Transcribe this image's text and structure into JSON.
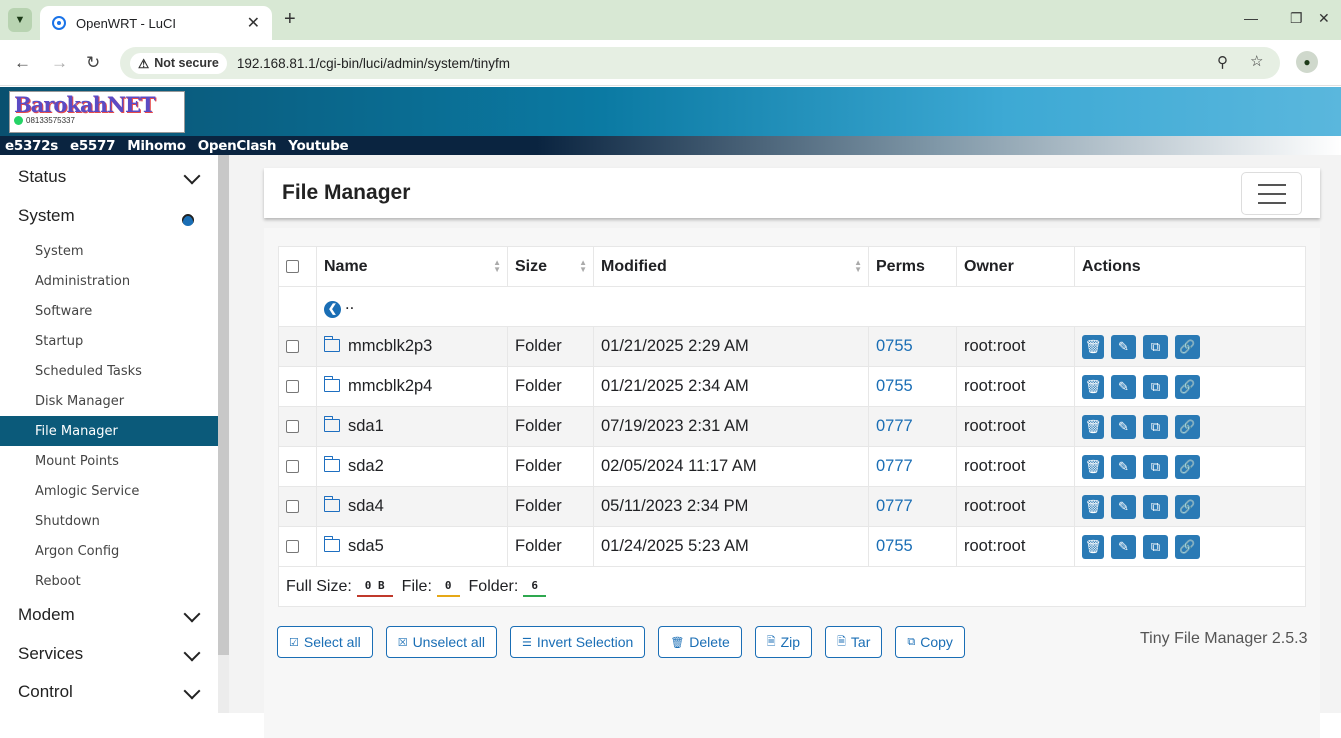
{
  "browser": {
    "tab_title": "OpenWRT - LuCI",
    "not_secure": "Not secure",
    "url": "192.168.81.1/cgi-bin/luci/admin/system/tinyfm"
  },
  "banner": {
    "logo_text": "BarokahNET",
    "logo_phone": "08133575337"
  },
  "topnav": [
    "e5372s",
    "e5577",
    "Mihomo",
    "OpenClash",
    "Youtube"
  ],
  "sidebar": {
    "status": "Status",
    "system": "System",
    "items": [
      "System",
      "Administration",
      "Software",
      "Startup",
      "Scheduled Tasks",
      "Disk Manager",
      "File Manager",
      "Mount Points",
      "Amlogic Service",
      "Shutdown",
      "Argon Config",
      "Reboot"
    ],
    "modem": "Modem",
    "services": "Services",
    "control": "Control"
  },
  "fm": {
    "title": "File Manager",
    "columns": {
      "name": "Name",
      "size": "Size",
      "modified": "Modified",
      "perms": "Perms",
      "owner": "Owner",
      "actions": "Actions"
    },
    "parent": "..",
    "rows": [
      {
        "name": "mmcblk2p3",
        "size": "Folder",
        "modified": "01/21/2025 2:29 AM",
        "perms": "0755",
        "owner": "root:root"
      },
      {
        "name": "mmcblk2p4",
        "size": "Folder",
        "modified": "01/21/2025 2:34 AM",
        "perms": "0755",
        "owner": "root:root"
      },
      {
        "name": "sda1",
        "size": "Folder",
        "modified": "07/19/2023 2:31 AM",
        "perms": "0777",
        "owner": "root:root"
      },
      {
        "name": "sda2",
        "size": "Folder",
        "modified": "02/05/2024 11:17 AM",
        "perms": "0777",
        "owner": "root:root"
      },
      {
        "name": "sda4",
        "size": "Folder",
        "modified": "05/11/2023 2:34 PM",
        "perms": "0777",
        "owner": "root:root"
      },
      {
        "name": "sda5",
        "size": "Folder",
        "modified": "01/24/2025 5:23 AM",
        "perms": "0755",
        "owner": "root:root"
      }
    ],
    "footer": {
      "full_size_label": "Full Size:",
      "full_size": "0 B",
      "file_label": "File:",
      "file": "0",
      "folder_label": "Folder:",
      "folder": "6"
    },
    "buttons": {
      "select_all": "Select all",
      "unselect_all": "Unselect all",
      "invert": "Invert Selection",
      "delete": "Delete",
      "zip": "Zip",
      "tar": "Tar",
      "copy": "Copy"
    },
    "version": "Tiny File Manager 2.5.3"
  }
}
